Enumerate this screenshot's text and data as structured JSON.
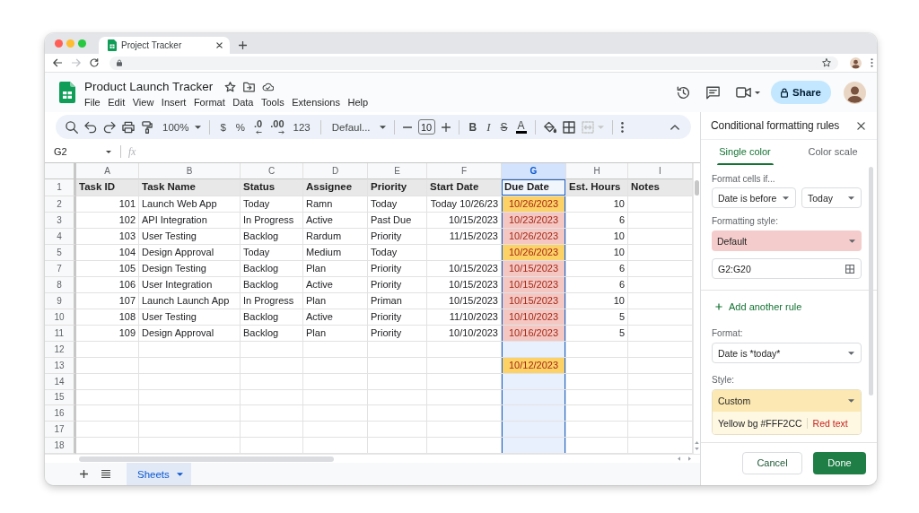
{
  "browser": {
    "tab_title": "Project Tracker"
  },
  "doc": {
    "title": "Product Launch Tracker",
    "menu": [
      "File",
      "Edit",
      "View",
      "Insert",
      "Format",
      "Data",
      "Tools",
      "Extensions",
      "Help"
    ],
    "share": "Share"
  },
  "toolbar": {
    "zoom": "100%",
    "currency": "$",
    "percent": "%",
    "decimal_less": ".0",
    "decimal_more": ".00",
    "number_format": "123",
    "font": "Defaul...",
    "font_size": "10",
    "bold": "B",
    "italic": "I",
    "strike": "S",
    "text_color": "A"
  },
  "formula_bar": {
    "cell_ref": "G2",
    "fx": "fx"
  },
  "sheet": {
    "columns": [
      {
        "letter": "A",
        "selected": false
      },
      {
        "letter": "B",
        "selected": false
      },
      {
        "letter": "C",
        "selected": false
      },
      {
        "letter": "D",
        "selected": false
      },
      {
        "letter": "E",
        "selected": false
      },
      {
        "letter": "F",
        "selected": false
      },
      {
        "letter": "G",
        "selected": true
      },
      {
        "letter": "H",
        "selected": false
      },
      {
        "letter": "I",
        "selected": false
      }
    ],
    "rows": [
      {
        "number": "1",
        "kind": "header",
        "cells": [
          "Task ID",
          "Task Name",
          "Status",
          "Assignee",
          "Priority",
          "Start Date",
          "Due Date",
          "Est. Hours",
          "Notes"
        ]
      },
      {
        "number": "2",
        "kind": "data",
        "cells": [
          "101",
          "Launch Web App",
          "Today",
          "Ramn",
          "Today",
          "Today 10/26/23",
          {
            "text": "10/26/2023",
            "color": "#fcd166"
          },
          "10",
          null
        ]
      },
      {
        "number": "3",
        "kind": "data",
        "cells": [
          "102",
          "API Integration",
          "In Progress",
          "Active",
          "Past Due",
          "10/15/2023",
          {
            "text": "10/23/2023",
            "color": "#f4c7c3"
          },
          "6",
          null
        ]
      },
      {
        "number": "4",
        "kind": "data",
        "cells": [
          "103",
          "User Testing",
          "Backlog",
          "Rardum",
          "Priority",
          "11/15/2023",
          {
            "text": "10/26/2023",
            "color": "#f4c7c3"
          },
          "10",
          null
        ]
      },
      {
        "number": "5",
        "kind": "data",
        "cells": [
          "104",
          "Design Approval",
          "Today",
          "Medium",
          "Today",
          null,
          {
            "text": "10/26/2023",
            "color": "#fcd166"
          },
          "10",
          null
        ]
      },
      {
        "number": "7",
        "kind": "data",
        "cells": [
          "105",
          "Design Testing",
          "Backlog",
          "Plan",
          "Priority",
          "10/15/2023",
          {
            "text": "10/15/2023",
            "color": "#f4c7c3"
          },
          "6",
          null
        ]
      },
      {
        "number": "8",
        "kind": "data",
        "cells": [
          "106",
          "User Integration",
          "Backlog",
          "Active",
          "Priority",
          "10/15/2023",
          {
            "text": "10/15/2023",
            "color": "#f4c7c3"
          },
          "6",
          null
        ]
      },
      {
        "number": "9",
        "kind": "data",
        "cells": [
          "107",
          "Launch Launch App",
          "In Progress",
          "Plan",
          "Priman",
          "10/15/2023",
          {
            "text": "10/15/2023",
            "color": "#f4c7c3"
          },
          "10",
          null
        ]
      },
      {
        "number": "10",
        "kind": "data",
        "cells": [
          "108",
          "User Testing",
          "Backlog",
          "Active",
          "Priority",
          "11/10/2023",
          {
            "text": "10/10/2023",
            "color": "#f4c7c3"
          },
          "5",
          null
        ]
      },
      {
        "number": "11",
        "kind": "data",
        "cells": [
          "109",
          "Design Approval",
          "Backlog",
          "Plan",
          "Priority",
          "10/10/2023",
          {
            "text": "10/16/2023",
            "color": "#f4c7c3"
          },
          "5",
          null
        ]
      },
      {
        "number": "12",
        "kind": "data"
      },
      {
        "number": "13",
        "kind": "data",
        "cells": [
          null,
          null,
          null,
          null,
          null,
          null,
          {
            "text": "10/12/2023",
            "color": "#fcd166"
          }
        ]
      },
      {
        "number": "14",
        "kind": "data"
      },
      {
        "number": "15",
        "kind": "data"
      },
      {
        "number": "16",
        "kind": "data"
      },
      {
        "number": "17",
        "kind": "data"
      },
      {
        "number": "18",
        "kind": "data"
      }
    ]
  },
  "sheet_tabs": [
    {
      "label": "Sheets",
      "selected": true
    }
  ],
  "panel": {
    "title": "Conditional formatting rules",
    "tabs": [
      {
        "label": "Single color",
        "selected": true
      },
      {
        "label": "Color scale",
        "selected": false
      }
    ],
    "rule": {
      "condition_label": "Format cells if...",
      "condition": "Date is before",
      "value": "Today",
      "style_label": "Formatting style:",
      "style": {
        "label": "Default",
        "color": "#f4cccc"
      },
      "range": "G2:G20"
    },
    "add_rule": "Add another rule",
    "rule2": {
      "format_label": "Format:",
      "format": "Date is *today*",
      "style_label": "Style:",
      "style": {
        "label": "Custom",
        "color": "#fce8b2"
      },
      "preview": [
        {
          "text": "Yellow bg #FFF2CC",
          "kind": "background"
        },
        {
          "text": "Red text",
          "kind": "text_color"
        }
      ]
    },
    "buttons": [
      {
        "label": "Cancel",
        "kind": "secondary"
      },
      {
        "label": "Done",
        "kind": "primary"
      }
    ]
  }
}
